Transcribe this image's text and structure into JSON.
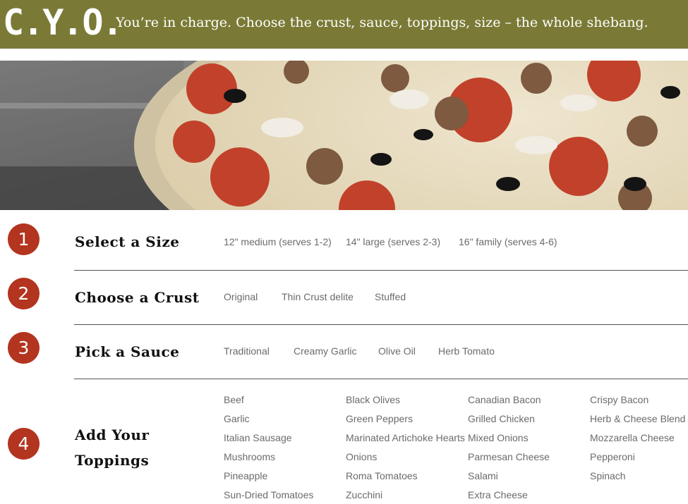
{
  "header": {
    "logo": "C.Y.O.",
    "tagline": "You’re in charge. Choose the crust, sauce, toppings, size – the whole shebang."
  },
  "hero_image": {
    "subject": "pizza-photo"
  },
  "steps": [
    {
      "number": "1",
      "title": "Select a Size",
      "options": [
        "12\" medium (serves 1-2)",
        "14\" large (serves 2-3)",
        "16\" family (serves 4-6)"
      ]
    },
    {
      "number": "2",
      "title": "Choose a Crust",
      "options": [
        "Original",
        "Thin Crust delite",
        "Stuffed"
      ]
    },
    {
      "number": "3",
      "title": "Pick a Sauce",
      "options": [
        "Traditional",
        "Creamy Garlic",
        "Olive Oil",
        "Herb Tomato"
      ]
    },
    {
      "number": "4",
      "title_line1": "Add Your",
      "title_line2": "Toppings",
      "toppings": [
        [
          "Beef",
          "Garlic",
          "Italian Sausage",
          "Mushrooms",
          "Pineapple",
          "Sun-Dried Tomatoes"
        ],
        [
          "Black Olives",
          "Green Peppers",
          "Marinated Artichoke Hearts",
          "Onions",
          "Roma Tomatoes",
          "Zucchini"
        ],
        [
          "Canadian Bacon",
          "Grilled Chicken",
          "Mixed Onions",
          "Parmesan Cheese",
          "Salami",
          "Extra Cheese"
        ],
        [
          "Crispy Bacon",
          "Herb & Cheese Blend",
          "Mozzarella Cheese",
          "Pepperoni",
          "Spinach"
        ]
      ]
    }
  ],
  "colors": {
    "header_bg": "#7a7a36",
    "badge": "#b3341f",
    "option_text": "#6b6b6b"
  }
}
